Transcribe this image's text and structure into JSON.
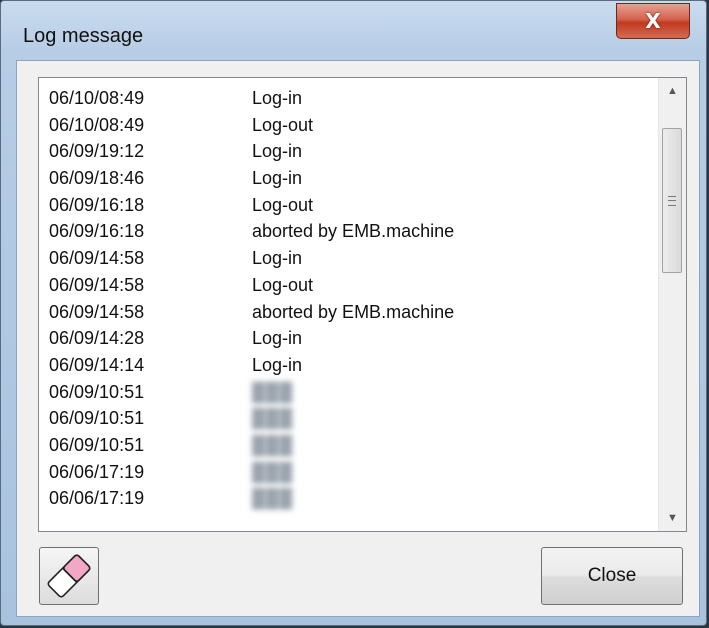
{
  "window": {
    "title": "Log message",
    "close_glyph": "X"
  },
  "log": {
    "rows": [
      {
        "time": "06/10/08:49",
        "message": "Log-in",
        "blurred": false
      },
      {
        "time": "06/10/08:49",
        "message": "Log-out",
        "blurred": false
      },
      {
        "time": "06/09/19:12",
        "message": "Log-in",
        "blurred": false
      },
      {
        "time": "06/09/18:46",
        "message": "Log-in",
        "blurred": false
      },
      {
        "time": "06/09/16:18",
        "message": "Log-out",
        "blurred": false
      },
      {
        "time": "06/09/16:18",
        "message": "aborted by EMB.machine",
        "blurred": false
      },
      {
        "time": "06/09/14:58",
        "message": "Log-in",
        "blurred": false
      },
      {
        "time": "06/09/14:58",
        "message": "Log-out",
        "blurred": false
      },
      {
        "time": "06/09/14:58",
        "message": "aborted by EMB.machine",
        "blurred": false
      },
      {
        "time": "06/09/14:28",
        "message": "Log-in",
        "blurred": false
      },
      {
        "time": "06/09/14:14",
        "message": "Log-in",
        "blurred": false
      },
      {
        "time": "06/09/10:51",
        "message": "",
        "blurred": true
      },
      {
        "time": "06/09/10:51",
        "message": "",
        "blurred": true
      },
      {
        "time": "06/09/10:51",
        "message": "",
        "blurred": true
      },
      {
        "time": "06/06/17:19",
        "message": "",
        "blurred": true
      },
      {
        "time": "06/06/17:19",
        "message": "",
        "blurred": true
      }
    ]
  },
  "buttons": {
    "close_label": "Close",
    "eraser_icon": "eraser-icon"
  },
  "colors": {
    "close_x_red": "#c2391f",
    "eraser_pink": "#f3a7c6"
  }
}
